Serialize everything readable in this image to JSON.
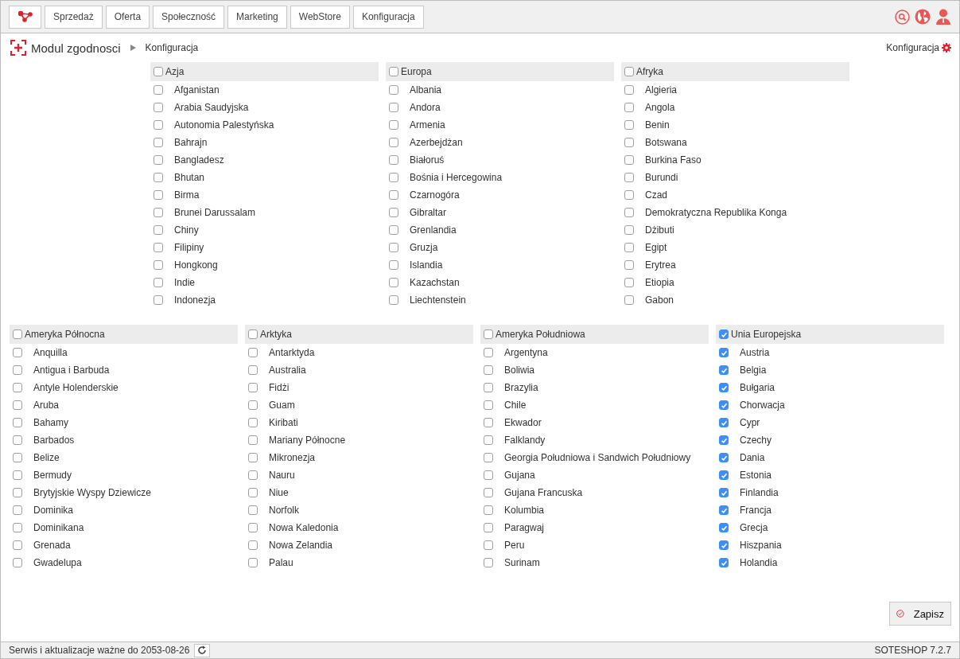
{
  "nav": {
    "tabs": [
      {
        "label": "Sprzedaż",
        "selected": false
      },
      {
        "label": "Oferta",
        "selected": false
      },
      {
        "label": "Społeczność",
        "selected": false
      },
      {
        "label": "Marketing",
        "selected": false
      },
      {
        "label": "WebStore",
        "selected": false
      },
      {
        "label": "Konfiguracja",
        "selected": false
      }
    ]
  },
  "breadcrumb": {
    "module": "Modul zgodnosci",
    "current": "Konfiguracja",
    "config_link": "Konfiguracja"
  },
  "region_rows": [
    [
      {
        "name": "Azja",
        "checked": false,
        "countries": [
          {
            "name": "Afganistan",
            "checked": false
          },
          {
            "name": "Arabia Saudyjska",
            "checked": false
          },
          {
            "name": "Autonomia Palestyńska",
            "checked": false
          },
          {
            "name": "Bahrajn",
            "checked": false
          },
          {
            "name": "Bangladesz",
            "checked": false
          },
          {
            "name": "Bhutan",
            "checked": false
          },
          {
            "name": "Birma",
            "checked": false
          },
          {
            "name": "Brunei Darussalam",
            "checked": false
          },
          {
            "name": "Chiny",
            "checked": false
          },
          {
            "name": "Filipiny",
            "checked": false
          },
          {
            "name": "Hongkong",
            "checked": false
          },
          {
            "name": "Indie",
            "checked": false
          },
          {
            "name": "Indonezja",
            "checked": false
          }
        ]
      },
      {
        "name": "Europa",
        "checked": false,
        "countries": [
          {
            "name": "Albania",
            "checked": false
          },
          {
            "name": "Andora",
            "checked": false
          },
          {
            "name": "Armenia",
            "checked": false
          },
          {
            "name": "Azerbejdżan",
            "checked": false
          },
          {
            "name": "Białoruś",
            "checked": false
          },
          {
            "name": "Bośnia i Hercegowina",
            "checked": false
          },
          {
            "name": "Czarnogóra",
            "checked": false
          },
          {
            "name": "Gibraltar",
            "checked": false
          },
          {
            "name": "Grenlandia",
            "checked": false
          },
          {
            "name": "Gruzja",
            "checked": false
          },
          {
            "name": "Islandia",
            "checked": false
          },
          {
            "name": "Kazachstan",
            "checked": false
          },
          {
            "name": "Liechtenstein",
            "checked": false
          }
        ]
      },
      {
        "name": "Afryka",
        "checked": false,
        "countries": [
          {
            "name": "Algieria",
            "checked": false
          },
          {
            "name": "Angola",
            "checked": false
          },
          {
            "name": "Benin",
            "checked": false
          },
          {
            "name": "Botswana",
            "checked": false
          },
          {
            "name": "Burkina Faso",
            "checked": false
          },
          {
            "name": "Burundi",
            "checked": false
          },
          {
            "name": "Czad",
            "checked": false
          },
          {
            "name": "Demokratyczna Republika Konga",
            "checked": false
          },
          {
            "name": "Dżibuti",
            "checked": false
          },
          {
            "name": "Egipt",
            "checked": false
          },
          {
            "name": "Erytrea",
            "checked": false
          },
          {
            "name": "Etiopia",
            "checked": false
          },
          {
            "name": "Gabon",
            "checked": false
          }
        ]
      }
    ],
    [
      {
        "name": "Ameryka Północna",
        "checked": false,
        "countries": [
          {
            "name": "Anquilla",
            "checked": false
          },
          {
            "name": "Antigua i Barbuda",
            "checked": false
          },
          {
            "name": "Antyle Holenderskie",
            "checked": false
          },
          {
            "name": "Aruba",
            "checked": false
          },
          {
            "name": "Bahamy",
            "checked": false
          },
          {
            "name": "Barbados",
            "checked": false
          },
          {
            "name": "Belize",
            "checked": false
          },
          {
            "name": "Bermudy",
            "checked": false
          },
          {
            "name": "Brytyjskie Wyspy Dziewicze",
            "checked": false
          },
          {
            "name": "Dominika",
            "checked": false
          },
          {
            "name": "Dominikana",
            "checked": false
          },
          {
            "name": "Grenada",
            "checked": false
          },
          {
            "name": "Gwadelupa",
            "checked": false
          }
        ]
      },
      {
        "name": "Arktyka",
        "checked": false,
        "countries": [
          {
            "name": "Antarktyda",
            "checked": false
          },
          {
            "name": "Australia",
            "checked": false
          },
          {
            "name": "Fidżi",
            "checked": false
          },
          {
            "name": "Guam",
            "checked": false
          },
          {
            "name": "Kiribati",
            "checked": false
          },
          {
            "name": "Mariany Północne",
            "checked": false
          },
          {
            "name": "Mikronezja",
            "checked": false
          },
          {
            "name": "Nauru",
            "checked": false
          },
          {
            "name": "Niue",
            "checked": false
          },
          {
            "name": "Norfolk",
            "checked": false
          },
          {
            "name": "Nowa Kaledonia",
            "checked": false
          },
          {
            "name": "Nowa Zelandia",
            "checked": false
          },
          {
            "name": "Palau",
            "checked": false
          }
        ]
      },
      {
        "name": "Ameryka Południowa",
        "checked": false,
        "countries": [
          {
            "name": "Argentyna",
            "checked": false
          },
          {
            "name": "Boliwia",
            "checked": false
          },
          {
            "name": "Brazylia",
            "checked": false
          },
          {
            "name": "Chile",
            "checked": false
          },
          {
            "name": "Ekwador",
            "checked": false
          },
          {
            "name": "Falklandy",
            "checked": false
          },
          {
            "name": "Georgia Południowa i Sandwich Południowy",
            "checked": false
          },
          {
            "name": "Gujana",
            "checked": false
          },
          {
            "name": "Gujana Francuska",
            "checked": false
          },
          {
            "name": "Kolumbia",
            "checked": false
          },
          {
            "name": "Paragwaj",
            "checked": false
          },
          {
            "name": "Peru",
            "checked": false
          },
          {
            "name": "Surinam",
            "checked": false
          }
        ]
      },
      {
        "name": "Unia Europejska",
        "checked": true,
        "countries": [
          {
            "name": "Austria",
            "checked": true
          },
          {
            "name": "Belgia",
            "checked": true
          },
          {
            "name": "Bułgaria",
            "checked": true
          },
          {
            "name": "Chorwacja",
            "checked": true
          },
          {
            "name": "Cypr",
            "checked": true
          },
          {
            "name": "Czechy",
            "checked": true
          },
          {
            "name": "Dania",
            "checked": true
          },
          {
            "name": "Estonia",
            "checked": true
          },
          {
            "name": "Finlandia",
            "checked": true
          },
          {
            "name": "Francja",
            "checked": true
          },
          {
            "name": "Grecja",
            "checked": true
          },
          {
            "name": "Hiszpania",
            "checked": true
          },
          {
            "name": "Holandia",
            "checked": true
          }
        ]
      }
    ]
  ],
  "save_button": "Zapisz",
  "status_bar": {
    "license": "Serwis i aktualizacje ważne do 2053-08-26",
    "version": "SOTESHOP 7.2.7"
  }
}
